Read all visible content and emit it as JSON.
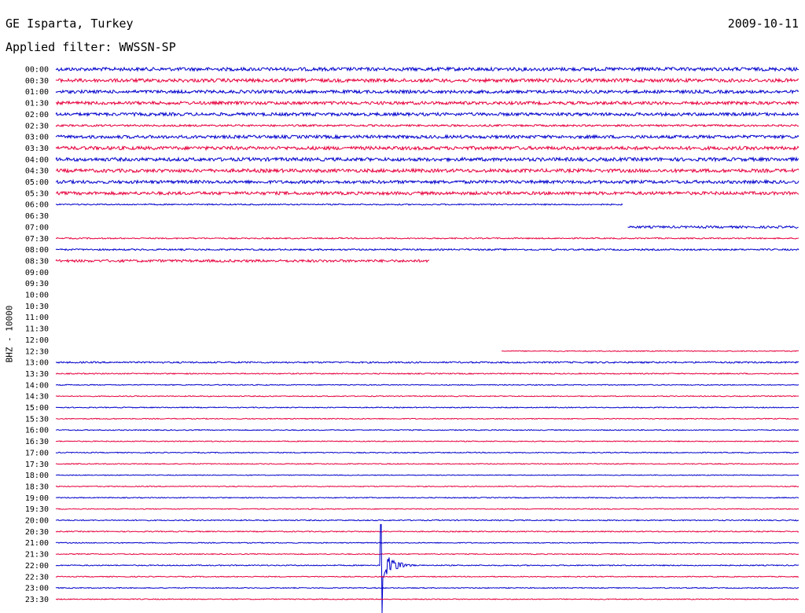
{
  "header": {
    "title": "GE Isparta, Turkey",
    "date": "2009-10-11",
    "filter": "Applied filter: WWSSN-SP",
    "channel": "BHZ - 10000"
  },
  "colors": {
    "blue": "#0000cc",
    "red": "#e6003c",
    "background": "#ffffff",
    "text": "#000000"
  },
  "chart_data": {
    "type": "line",
    "title": "GE Isparta, Turkey",
    "subtitle": "Applied filter: WWSSN-SP",
    "ylabel": "BHZ - 10000",
    "xlabel": "",
    "row_duration_min": 30,
    "xlim": [
      0,
      30
    ],
    "series_colors": [
      "blue",
      "red"
    ],
    "rows": [
      {
        "label": "00:00",
        "segments": [
          [
            0,
            30
          ]
        ],
        "amplitude": 2.2
      },
      {
        "label": "00:30",
        "segments": [
          [
            0,
            30
          ]
        ],
        "amplitude": 2.2
      },
      {
        "label": "01:00",
        "segments": [
          [
            0,
            30
          ]
        ],
        "amplitude": 2.0
      },
      {
        "label": "01:30",
        "segments": [
          [
            0,
            30
          ]
        ],
        "amplitude": 2.0
      },
      {
        "label": "02:00",
        "segments": [
          [
            0,
            30
          ]
        ],
        "amplitude": 2.0
      },
      {
        "label": "02:30",
        "segments": [
          [
            0,
            30
          ]
        ],
        "amplitude": 1.2
      },
      {
        "label": "03:00",
        "segments": [
          [
            0,
            30
          ]
        ],
        "amplitude": 2.0
      },
      {
        "label": "03:30",
        "segments": [
          [
            0,
            30
          ]
        ],
        "amplitude": 2.2
      },
      {
        "label": "04:00",
        "segments": [
          [
            0,
            30
          ]
        ],
        "amplitude": 2.2
      },
      {
        "label": "04:30",
        "segments": [
          [
            0,
            30
          ]
        ],
        "amplitude": 2.2
      },
      {
        "label": "05:00",
        "segments": [
          [
            0,
            30
          ]
        ],
        "amplitude": 2.0
      },
      {
        "label": "05:30",
        "segments": [
          [
            0,
            30
          ]
        ],
        "amplitude": 2.0
      },
      {
        "label": "06:00",
        "segments": [
          [
            0,
            22.9
          ]
        ],
        "amplitude": 0.8
      },
      {
        "label": "06:30",
        "segments": [],
        "amplitude": 0
      },
      {
        "label": "07:00",
        "segments": [
          [
            23.1,
            30
          ]
        ],
        "amplitude": 1.4
      },
      {
        "label": "07:30",
        "segments": [
          [
            0,
            30
          ]
        ],
        "amplitude": 0.8
      },
      {
        "label": "08:00",
        "segments": [
          [
            0,
            30
          ]
        ],
        "amplitude": 1.0
      },
      {
        "label": "08:30",
        "segments": [
          [
            0,
            15.1
          ]
        ],
        "amplitude": 1.6
      },
      {
        "label": "09:00",
        "segments": [],
        "amplitude": 0
      },
      {
        "label": "09:30",
        "segments": [],
        "amplitude": 0
      },
      {
        "label": "10:00",
        "segments": [],
        "amplitude": 0
      },
      {
        "label": "10:30",
        "segments": [],
        "amplitude": 0
      },
      {
        "label": "11:00",
        "segments": [],
        "amplitude": 0
      },
      {
        "label": "11:30",
        "segments": [],
        "amplitude": 0
      },
      {
        "label": "12:00",
        "segments": [],
        "amplitude": 0
      },
      {
        "label": "12:30",
        "segments": [
          [
            18,
            30
          ]
        ],
        "amplitude": 0.6
      },
      {
        "label": "13:00",
        "segments": [
          [
            0,
            30
          ]
        ],
        "amplitude": 1.0
      },
      {
        "label": "13:30",
        "segments": [
          [
            0,
            30
          ]
        ],
        "amplitude": 0.7
      },
      {
        "label": "14:00",
        "segments": [
          [
            0,
            30
          ]
        ],
        "amplitude": 0.6
      },
      {
        "label": "14:30",
        "segments": [
          [
            0,
            30
          ]
        ],
        "amplitude": 0.6
      },
      {
        "label": "15:00",
        "segments": [
          [
            0,
            30
          ]
        ],
        "amplitude": 0.6
      },
      {
        "label": "15:30",
        "segments": [
          [
            0,
            30
          ]
        ],
        "amplitude": 0.6
      },
      {
        "label": "16:00",
        "segments": [
          [
            0,
            30
          ]
        ],
        "amplitude": 0.6
      },
      {
        "label": "16:30",
        "segments": [
          [
            0,
            30
          ]
        ],
        "amplitude": 0.6
      },
      {
        "label": "17:00",
        "segments": [
          [
            0,
            30
          ]
        ],
        "amplitude": 0.6
      },
      {
        "label": "17:30",
        "segments": [
          [
            0,
            30
          ]
        ],
        "amplitude": 0.6
      },
      {
        "label": "18:00",
        "segments": [
          [
            0,
            30
          ]
        ],
        "amplitude": 0.5
      },
      {
        "label": "18:30",
        "segments": [
          [
            0,
            30
          ]
        ],
        "amplitude": 0.6
      },
      {
        "label": "19:00",
        "segments": [
          [
            0,
            30
          ]
        ],
        "amplitude": 0.6
      },
      {
        "label": "19:30",
        "segments": [
          [
            0,
            30
          ]
        ],
        "amplitude": 0.6
      },
      {
        "label": "20:00",
        "segments": [
          [
            0,
            30
          ]
        ],
        "amplitude": 0.7
      },
      {
        "label": "20:30",
        "segments": [
          [
            0,
            30
          ]
        ],
        "amplitude": 0.7
      },
      {
        "label": "21:00",
        "segments": [
          [
            0,
            30
          ]
        ],
        "amplitude": 0.6
      },
      {
        "label": "21:30",
        "segments": [
          [
            0,
            30
          ]
        ],
        "amplitude": 0.6
      },
      {
        "label": "22:00",
        "segments": [
          [
            0,
            30
          ]
        ],
        "amplitude": 0.7,
        "event": {
          "minute": 13.1,
          "up": 52,
          "down": 62
        }
      },
      {
        "label": "22:30",
        "segments": [
          [
            0,
            30
          ]
        ],
        "amplitude": 0.6
      },
      {
        "label": "23:00",
        "segments": [
          [
            0,
            30
          ]
        ],
        "amplitude": 0.6
      },
      {
        "label": "23:30",
        "segments": [
          [
            0,
            30
          ]
        ],
        "amplitude": 0.6
      }
    ]
  }
}
